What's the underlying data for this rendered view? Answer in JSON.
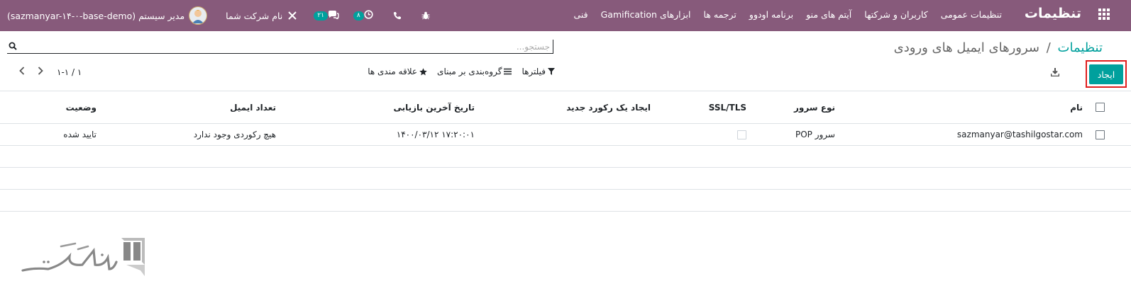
{
  "nav": {
    "brand": "تنظیمات",
    "menu": [
      "تنظیمات عمومی",
      "کاربران و شرکتها",
      "آیتم های منو",
      "برنامه اودوو",
      "ترجمه ها",
      "ابزارهای Gamification",
      "فنی"
    ],
    "company": "نام شرکت شما",
    "activity_count": "۸",
    "messages_count": "۲۱",
    "user": "مدیر سیستم (sazmanyar-۱۴-۰-base-demo)"
  },
  "breadcrumb": {
    "root": "تنظیمات",
    "separator": "/",
    "current": "سرورهای ایمیل های ورودی"
  },
  "search": {
    "placeholder": "جستجو..."
  },
  "toolbar": {
    "create_label": "ایجاد",
    "filters_label": "فیلترها",
    "groupby_label": "گروه‌بندی بر مبنای",
    "favorites_label": "علاقه مندی ها"
  },
  "pager": {
    "value": "۱-۱ / ۱"
  },
  "table": {
    "columns": [
      "نام",
      "نوع سرور",
      "SSL/TLS",
      "ایجاد یک رکورد جدید",
      "تاریخ آخرین بازیابی",
      "تعداد ایمیل",
      "وضعیت"
    ],
    "rows": [
      {
        "name": "sazmanyar@tashilgostar.com",
        "server_type": "سرور POP",
        "ssl": false,
        "create_record": "",
        "last_fetch": "۱۴۰۰/۰۳/۱۲ ۱۷:۲۰:۰۱",
        "email_count": "هیچ رکوردی وجود ندارد",
        "state": "تایید شده"
      }
    ]
  },
  "colors": {
    "navbar": "#875A7B",
    "accent": "#00A09D",
    "highlight": "#e01e1e"
  },
  "icons": [
    "apps-grid-icon",
    "close-tools-icon",
    "chat-icon",
    "clock-icon",
    "phone-icon",
    "bug-icon",
    "search-icon",
    "download-icon",
    "filter-icon",
    "list-icon",
    "star-icon",
    "chevron-left-icon",
    "chevron-right-icon"
  ]
}
